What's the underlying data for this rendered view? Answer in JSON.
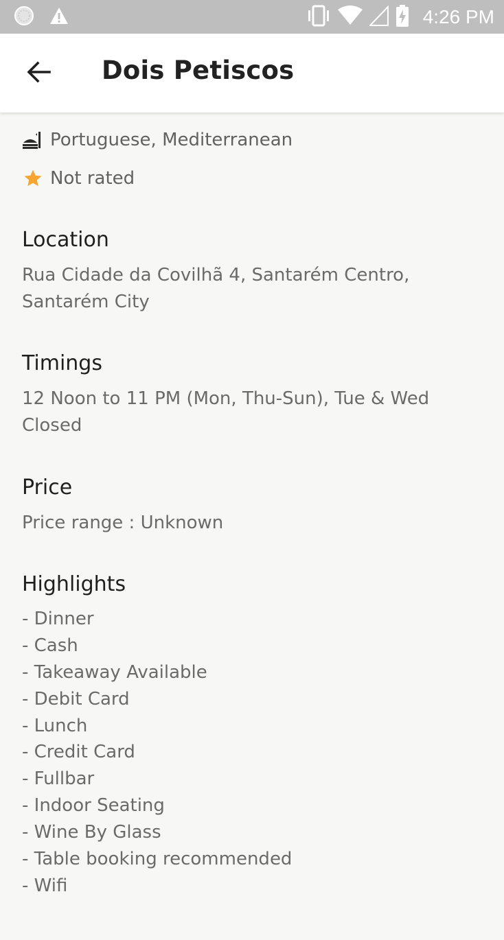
{
  "status_bar": {
    "time": "4:26 PM",
    "icons": [
      "notification-dot-icon",
      "warning-icon",
      "vibrate-icon",
      "wifi-icon",
      "cellular-signal-icon",
      "battery-charging-icon"
    ]
  },
  "app_bar": {
    "title": "Dois Petiscos",
    "back_icon": "back-arrow-icon"
  },
  "restaurant": {
    "cuisine": "Portuguese, Mediterranean",
    "rating": "Not rated",
    "accent_color": "#f7a531"
  },
  "location": {
    "title": "Location",
    "address": "Rua Cidade da Covilhã 4, Santarém Centro, Santarém City"
  },
  "timings": {
    "title": "Timings",
    "hours": "12 Noon to 11 PM (Mon, Thu-Sun), Tue & Wed Closed"
  },
  "price": {
    "title": "Price",
    "range": "Price range : Unknown"
  },
  "highlights": {
    "title": "Highlights",
    "items": [
      "- Dinner",
      "- Cash",
      "- Takeaway Available",
      "- Debit Card",
      "- Lunch",
      "- Credit Card",
      "- Fullbar",
      "- Indoor Seating",
      "- Wine By Glass",
      "- Table booking recommended",
      "- Wifi"
    ]
  }
}
